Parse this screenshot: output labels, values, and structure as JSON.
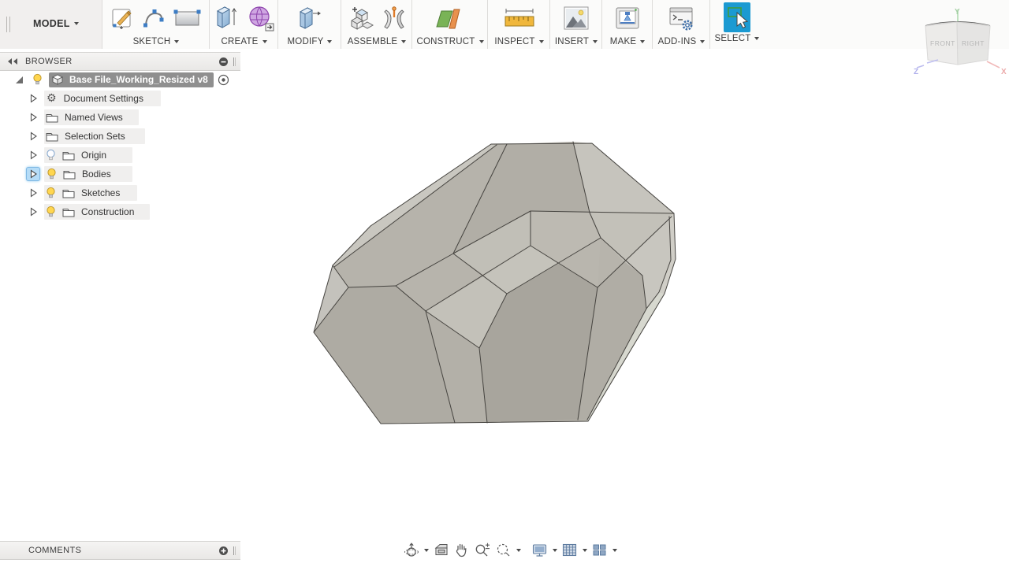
{
  "toolbar": {
    "model_label": "MODEL",
    "groups": [
      {
        "label": "SKETCH",
        "icons": [
          "create-sketch-icon",
          "three-point-arc-icon",
          "two-point-rectangle-icon"
        ]
      },
      {
        "label": "CREATE",
        "icons": [
          "extrude-icon",
          "create-form-icon"
        ]
      },
      {
        "label": "MODIFY",
        "icons": [
          "press-pull-icon"
        ]
      },
      {
        "label": "ASSEMBLE",
        "icons": [
          "new-component-icon",
          "joint-icon"
        ]
      },
      {
        "label": "CONSTRUCT",
        "icons": [
          "construction-plane-icon"
        ]
      },
      {
        "label": "INSPECT",
        "icons": [
          "measure-icon"
        ]
      },
      {
        "label": "INSERT",
        "icons": [
          "insert-image-icon"
        ]
      },
      {
        "label": "MAKE",
        "icons": [
          "3d-print-icon"
        ]
      },
      {
        "label": "ADD-INS",
        "icons": [
          "scripts-and-addins-icon"
        ]
      },
      {
        "label": "SELECT",
        "icons": [
          "select-icon"
        ]
      }
    ]
  },
  "browser": {
    "title": "BROWSER",
    "root_item": {
      "label": "Base File_Working_Resized v8",
      "bulb": "on",
      "icon": "component-cube-icon"
    },
    "items": [
      {
        "label": "Document Settings",
        "icon": "gear-icon",
        "bulb": null,
        "expanded": false
      },
      {
        "label": "Named Views",
        "icon": "folder-icon",
        "bulb": null,
        "expanded": false
      },
      {
        "label": "Selection Sets",
        "icon": "folder-icon",
        "bulb": null,
        "expanded": false
      },
      {
        "label": "Origin",
        "icon": "folder-icon",
        "bulb": "off",
        "expanded": false
      },
      {
        "label": "Bodies",
        "icon": "folder-icon",
        "bulb": "on",
        "expanded": false,
        "arrow_highlighted": true
      },
      {
        "label": "Sketches",
        "icon": "folder-icon",
        "bulb": "on",
        "expanded": false
      },
      {
        "label": "Construction",
        "icon": "folder-icon",
        "bulb": "on",
        "expanded": false
      }
    ]
  },
  "comments": {
    "title": "COMMENTS"
  },
  "viewcube": {
    "front_label": "FRONT",
    "right_label": "RIGHT",
    "axis_x": "X",
    "axis_y": "Y",
    "axis_z": "Z"
  },
  "navbar": {
    "icons": [
      "orbit-icon",
      "look-at-icon",
      "pan-icon",
      "zoom-icon",
      "zoom-window-icon",
      "display-settings-icon",
      "grid-display-icon",
      "viewports-icon"
    ]
  },
  "colors": {
    "select_active_bg": "#1b9ad2",
    "root_highlight": "#8f8f8f",
    "bodies_arrow_highlight": "#b5dcf7",
    "bulb_on": "#ffd64f",
    "axis_x_color": "#e99090",
    "axis_y_color": "#85c985",
    "axis_z_color": "#9595e6"
  }
}
